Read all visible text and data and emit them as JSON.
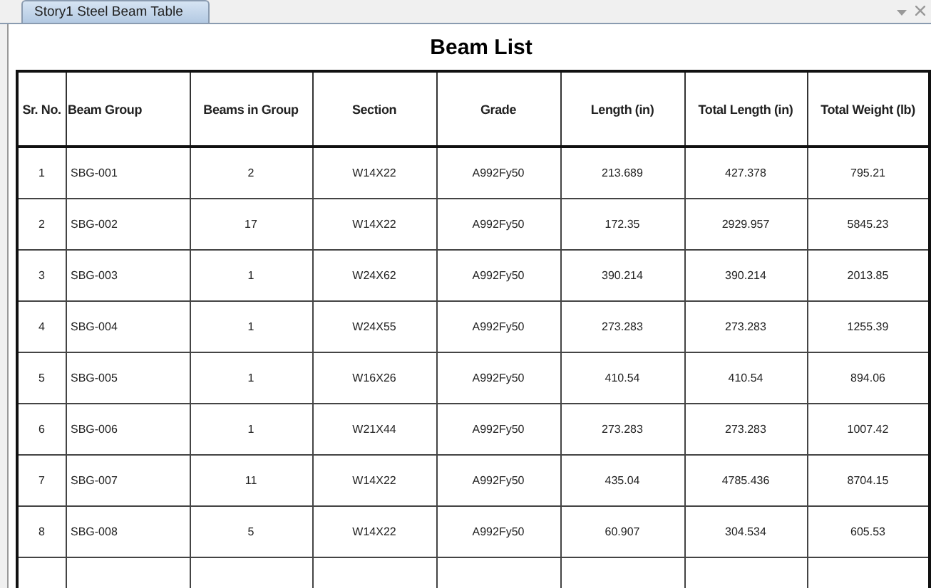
{
  "tab": {
    "label": "Story1 Steel Beam Table",
    "selected": true
  },
  "title": "Beam List",
  "table": {
    "columns": [
      "Sr. No.",
      "Beam Group",
      "Beams in Group",
      "Section",
      "Grade",
      "Length (in)",
      "Total Length (in)",
      "Total Weight (lb)"
    ],
    "rows": [
      [
        "1",
        "SBG-001",
        "2",
        "W14X22",
        "A992Fy50",
        "213.689",
        "427.378",
        "795.21"
      ],
      [
        "2",
        "SBG-002",
        "17",
        "W14X22",
        "A992Fy50",
        "172.35",
        "2929.957",
        "5845.23"
      ],
      [
        "3",
        "SBG-003",
        "1",
        "W24X62",
        "A992Fy50",
        "390.214",
        "390.214",
        "2013.85"
      ],
      [
        "4",
        "SBG-004",
        "1",
        "W24X55",
        "A992Fy50",
        "273.283",
        "273.283",
        "1255.39"
      ],
      [
        "5",
        "SBG-005",
        "1",
        "W16X26",
        "A992Fy50",
        "410.54",
        "410.54",
        "894.06"
      ],
      [
        "6",
        "SBG-006",
        "1",
        "W21X44",
        "A992Fy50",
        "273.283",
        "273.283",
        "1007.42"
      ],
      [
        "7",
        "SBG-007",
        "11",
        "W14X22",
        "A992Fy50",
        "435.04",
        "4785.436",
        "8704.15"
      ],
      [
        "8",
        "SBG-008",
        "5",
        "W14X22",
        "A992Fy50",
        "60.907",
        "304.534",
        "605.53"
      ]
    ]
  }
}
